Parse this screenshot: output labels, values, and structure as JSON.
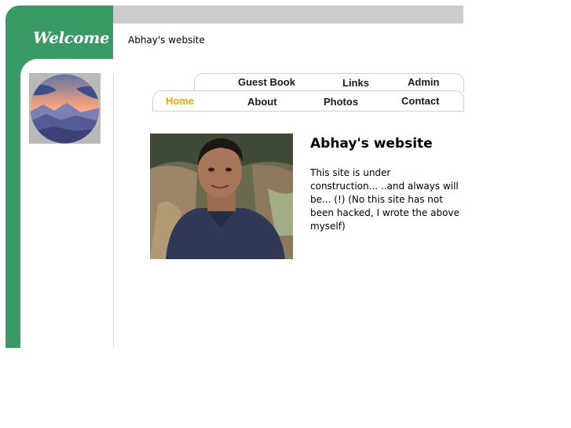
{
  "sidebar": {
    "welcome_text": "Welcome to"
  },
  "header": {
    "site_name": "Abhay's website"
  },
  "nav": {
    "row1": [
      {
        "label": "Guest Book"
      },
      {
        "label": "Links"
      },
      {
        "label": "Admin"
      }
    ],
    "row2": [
      {
        "label": "Home",
        "active": true
      },
      {
        "label": "About"
      },
      {
        "label": "Photos"
      },
      {
        "label": "Contact"
      }
    ]
  },
  "main": {
    "title": "Abhay's website",
    "body": "This site is under construction... ..and always will be... (!) (No this site has not been hacked, I wrote the above myself)"
  },
  "colors": {
    "green": "#3a9a66",
    "active_tab": "#e3a51c",
    "bar_gray": "#cccccc"
  }
}
